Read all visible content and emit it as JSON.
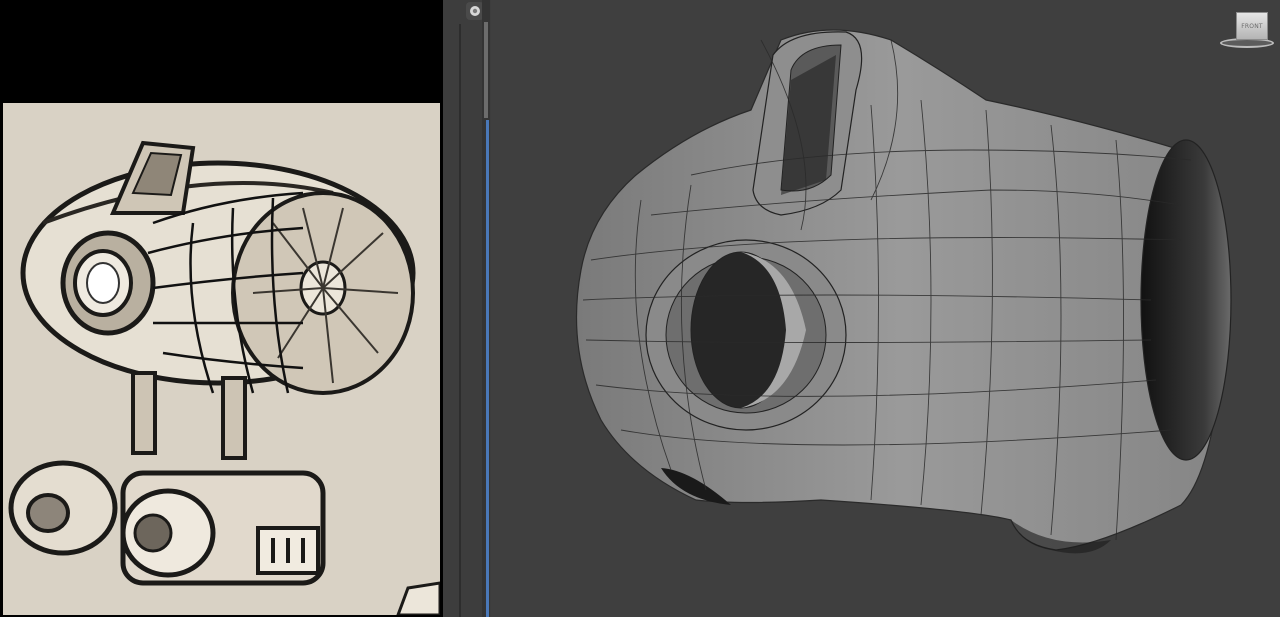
{
  "viewport": {
    "background_color": "#3f3f3f",
    "viewcube": {
      "face_label": "FRONT",
      "icon": "viewcube-icon"
    }
  },
  "reference_panel": {
    "background_color": "#000000",
    "image": "robot-concept-sketch"
  },
  "splitter": {
    "button_icon": "teapot-icon",
    "active_color": "#4a78b8"
  },
  "model": {
    "surface_color": "#8c8c8c",
    "wire_color": "#2a2a2a"
  }
}
